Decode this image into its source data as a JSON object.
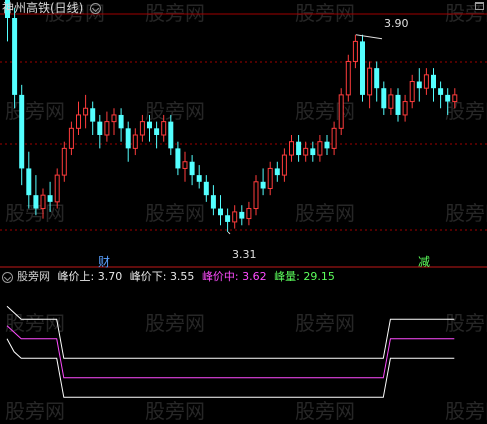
{
  "title": "神州高铁(日线)",
  "watermark": "股旁网",
  "annotations": {
    "high": "3.90",
    "low": "3.31",
    "event_left": "财",
    "event_right": "减"
  },
  "indicator": {
    "name": "股旁网",
    "upper_label": "峰价上:",
    "upper_value": "3.70",
    "lower_label": "峰价下:",
    "lower_value": "3.55",
    "mid_label": "峰价中:",
    "mid_value": "3.62",
    "vol_label": "峰量:",
    "vol_value": "29.15"
  },
  "colors": {
    "background": "#000000",
    "up": "#ff3c3c",
    "down": "#54ffff",
    "grid": "#a00000",
    "white_line": "#ffffff",
    "mid_line": "#ff4cff",
    "vol_text": "#5cff5c",
    "title_text": "#d8d8d8",
    "event_blue": "#5aa0ff",
    "event_green": "#5cff5c"
  },
  "icons": {
    "collapse_main": "chevron-circle-icon",
    "collapse_ind": "chevron-circle-icon",
    "window_menu": "window-icon"
  },
  "candles": [
    [
      4.05,
      3.95,
      4.15,
      3.88
    ],
    [
      3.95,
      3.72,
      3.98,
      3.68
    ],
    [
      3.72,
      3.5,
      3.75,
      3.45
    ],
    [
      3.5,
      3.42,
      3.55,
      3.38
    ],
    [
      3.42,
      3.38,
      3.48,
      3.36
    ],
    [
      3.38,
      3.42,
      3.44,
      3.35
    ],
    [
      3.42,
      3.4,
      3.46,
      3.37
    ],
    [
      3.4,
      3.48,
      3.5,
      3.38
    ],
    [
      3.48,
      3.56,
      3.58,
      3.46
    ],
    [
      3.56,
      3.62,
      3.64,
      3.54
    ],
    [
      3.62,
      3.66,
      3.7,
      3.6
    ],
    [
      3.66,
      3.68,
      3.72,
      3.62
    ],
    [
      3.68,
      3.64,
      3.7,
      3.6
    ],
    [
      3.64,
      3.6,
      3.66,
      3.56
    ],
    [
      3.6,
      3.64,
      3.67,
      3.58
    ],
    [
      3.64,
      3.66,
      3.68,
      3.6
    ],
    [
      3.66,
      3.62,
      3.68,
      3.58
    ],
    [
      3.62,
      3.56,
      3.64,
      3.52
    ],
    [
      3.56,
      3.6,
      3.62,
      3.54
    ],
    [
      3.6,
      3.64,
      3.66,
      3.58
    ],
    [
      3.64,
      3.62,
      3.66,
      3.58
    ],
    [
      3.62,
      3.6,
      3.64,
      3.56
    ],
    [
      3.6,
      3.64,
      3.66,
      3.58
    ],
    [
      3.64,
      3.56,
      3.66,
      3.54
    ],
    [
      3.56,
      3.5,
      3.58,
      3.48
    ],
    [
      3.5,
      3.52,
      3.55,
      3.46
    ],
    [
      3.52,
      3.48,
      3.54,
      3.45
    ],
    [
      3.48,
      3.46,
      3.51,
      3.44
    ],
    [
      3.46,
      3.42,
      3.48,
      3.4
    ],
    [
      3.42,
      3.38,
      3.45,
      3.36
    ],
    [
      3.38,
      3.36,
      3.42,
      3.33
    ],
    [
      3.36,
      3.34,
      3.38,
      3.31
    ],
    [
      3.34,
      3.37,
      3.39,
      3.32
    ],
    [
      3.37,
      3.35,
      3.39,
      3.33
    ],
    [
      3.35,
      3.38,
      3.4,
      3.33
    ],
    [
      3.38,
      3.46,
      3.48,
      3.36
    ],
    [
      3.46,
      3.44,
      3.5,
      3.42
    ],
    [
      3.44,
      3.5,
      3.52,
      3.42
    ],
    [
      3.5,
      3.48,
      3.52,
      3.46
    ],
    [
      3.48,
      3.54,
      3.56,
      3.46
    ],
    [
      3.54,
      3.58,
      3.6,
      3.52
    ],
    [
      3.58,
      3.54,
      3.6,
      3.52
    ],
    [
      3.54,
      3.56,
      3.58,
      3.52
    ],
    [
      3.56,
      3.54,
      3.58,
      3.52
    ],
    [
      3.54,
      3.58,
      3.6,
      3.52
    ],
    [
      3.58,
      3.56,
      3.6,
      3.54
    ],
    [
      3.56,
      3.62,
      3.64,
      3.54
    ],
    [
      3.62,
      3.72,
      3.74,
      3.6
    ],
    [
      3.72,
      3.82,
      3.84,
      3.7
    ],
    [
      3.82,
      3.88,
      3.9,
      3.8
    ],
    [
      3.88,
      3.72,
      3.9,
      3.7
    ],
    [
      3.72,
      3.8,
      3.82,
      3.68
    ],
    [
      3.8,
      3.74,
      3.82,
      3.7
    ],
    [
      3.74,
      3.68,
      3.76,
      3.66
    ],
    [
      3.68,
      3.72,
      3.74,
      3.66
    ],
    [
      3.72,
      3.66,
      3.74,
      3.64
    ],
    [
      3.66,
      3.7,
      3.72,
      3.64
    ],
    [
      3.7,
      3.76,
      3.78,
      3.68
    ],
    [
      3.76,
      3.74,
      3.8,
      3.7
    ],
    [
      3.74,
      3.78,
      3.8,
      3.72
    ],
    [
      3.78,
      3.74,
      3.8,
      3.7
    ],
    [
      3.74,
      3.72,
      3.76,
      3.68
    ],
    [
      3.72,
      3.7,
      3.74,
      3.66
    ],
    [
      3.7,
      3.72,
      3.74,
      3.68
    ]
  ],
  "indicator_series": {
    "upper": [
      3.8,
      3.78,
      3.76,
      3.76,
      3.76,
      3.76,
      3.76,
      3.76,
      3.64,
      3.64,
      3.64,
      3.64,
      3.64,
      3.64,
      3.64,
      3.64,
      3.64,
      3.64,
      3.64,
      3.64,
      3.64,
      3.64,
      3.64,
      3.64,
      3.64,
      3.64,
      3.64,
      3.64,
      3.64,
      3.64,
      3.64,
      3.64,
      3.64,
      3.64,
      3.64,
      3.64,
      3.64,
      3.64,
      3.64,
      3.64,
      3.64,
      3.64,
      3.64,
      3.64,
      3.64,
      3.64,
      3.64,
      3.64,
      3.64,
      3.64,
      3.64,
      3.64,
      3.64,
      3.64,
      3.76,
      3.76,
      3.76,
      3.76,
      3.76,
      3.76,
      3.76,
      3.76,
      3.76,
      3.76
    ],
    "mid": [
      3.74,
      3.72,
      3.7,
      3.7,
      3.7,
      3.7,
      3.7,
      3.7,
      3.58,
      3.58,
      3.58,
      3.58,
      3.58,
      3.58,
      3.58,
      3.58,
      3.58,
      3.58,
      3.58,
      3.58,
      3.58,
      3.58,
      3.58,
      3.58,
      3.58,
      3.58,
      3.58,
      3.58,
      3.58,
      3.58,
      3.58,
      3.58,
      3.58,
      3.58,
      3.58,
      3.58,
      3.58,
      3.58,
      3.58,
      3.58,
      3.58,
      3.58,
      3.58,
      3.58,
      3.58,
      3.58,
      3.58,
      3.58,
      3.58,
      3.58,
      3.58,
      3.58,
      3.58,
      3.58,
      3.7,
      3.7,
      3.7,
      3.7,
      3.7,
      3.7,
      3.7,
      3.7,
      3.7,
      3.7
    ],
    "lower": [
      3.7,
      3.66,
      3.64,
      3.64,
      3.64,
      3.64,
      3.64,
      3.64,
      3.52,
      3.52,
      3.52,
      3.52,
      3.52,
      3.52,
      3.52,
      3.52,
      3.52,
      3.52,
      3.52,
      3.52,
      3.52,
      3.52,
      3.52,
      3.52,
      3.52,
      3.52,
      3.52,
      3.52,
      3.52,
      3.52,
      3.52,
      3.52,
      3.52,
      3.52,
      3.52,
      3.52,
      3.52,
      3.52,
      3.52,
      3.52,
      3.52,
      3.52,
      3.52,
      3.52,
      3.52,
      3.52,
      3.52,
      3.52,
      3.52,
      3.52,
      3.52,
      3.52,
      3.52,
      3.52,
      3.64,
      3.64,
      3.64,
      3.64,
      3.64,
      3.64,
      3.64,
      3.64,
      3.64,
      3.64
    ]
  }
}
